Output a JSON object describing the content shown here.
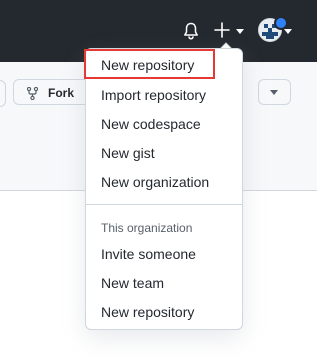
{
  "header": {
    "icons": [
      "bell-icon",
      "plus-icon",
      "avatar"
    ],
    "notification_color": "#2f81f7",
    "background": "#24292f"
  },
  "repo_bar": {
    "fork_label": "Fork"
  },
  "create_menu": {
    "items": [
      {
        "label": "New repository"
      },
      {
        "label": "Import repository"
      },
      {
        "label": "New codespace"
      },
      {
        "label": "New gist"
      },
      {
        "label": "New organization"
      }
    ],
    "section_header": "This organization",
    "org_items": [
      {
        "label": "Invite someone"
      },
      {
        "label": "New team"
      },
      {
        "label": "New repository"
      }
    ],
    "highlight_color": "#e53935"
  }
}
